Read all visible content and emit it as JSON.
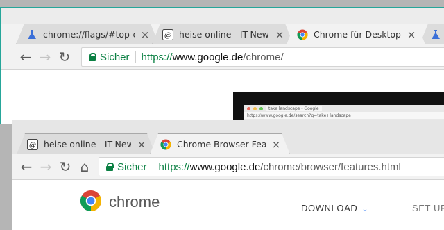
{
  "window_back": {
    "tabs": [
      {
        "title": "chrome://flags/#top-chrome-md",
        "icon": "flask-icon"
      },
      {
        "title": "heise online - IT-News, Nachrichten",
        "icon": "heise-icon"
      },
      {
        "title": "Chrome für Desktop-Computer",
        "icon": "chrome-icon"
      }
    ],
    "security_label": "Sicher",
    "url": {
      "scheme": "https://",
      "host": "www.google.de",
      "path": "/chrome/"
    },
    "embedded": {
      "tab_title": "take landscape - Google",
      "url": "https://www.google.de/search?q=take+landscape"
    }
  },
  "window_front": {
    "tabs": [
      {
        "title": "heise online - IT-News, Nachrichten",
        "icon": "heise-icon"
      },
      {
        "title": "Chrome Browser Features",
        "icon": "chrome-icon"
      }
    ],
    "security_label": "Sicher",
    "url": {
      "scheme": "https://",
      "host": "www.google.de",
      "path": "/chrome/browser/features.html"
    },
    "page": {
      "brand": "chrome",
      "nav_download": "DOWNLOAD",
      "nav_setup": "SET UP"
    }
  },
  "colors": {
    "secure_green": "#0b8043",
    "accent_teal": "#26a69a",
    "google_blue": "#4285f4"
  }
}
